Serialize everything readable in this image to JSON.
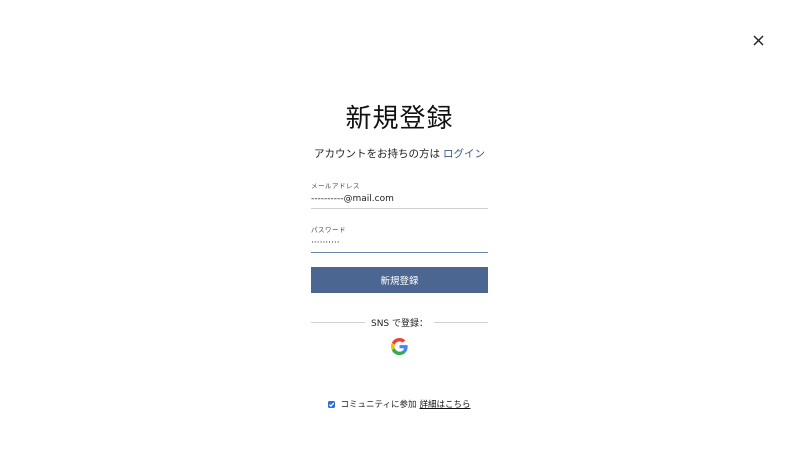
{
  "dialog": {
    "title": "新規登録",
    "subtitle_text": "アカウントをお持ちの方は",
    "login_link": "ログイン",
    "close_icon": "close-icon"
  },
  "form": {
    "email": {
      "label": "メールアドレス",
      "value": "----------@mail.com"
    },
    "password": {
      "label": "パスワード",
      "value": "··········"
    },
    "submit_label": "新規登録"
  },
  "sns": {
    "divider_text": "SNS で登録：",
    "google_icon": "google-icon"
  },
  "community": {
    "checked": true,
    "label": "コミュニティに参加",
    "details_link": "詳細はこちら"
  },
  "colors": {
    "primary": "#4b6690",
    "link": "#3d5a8a",
    "checkbox": "#2d6fd6"
  }
}
